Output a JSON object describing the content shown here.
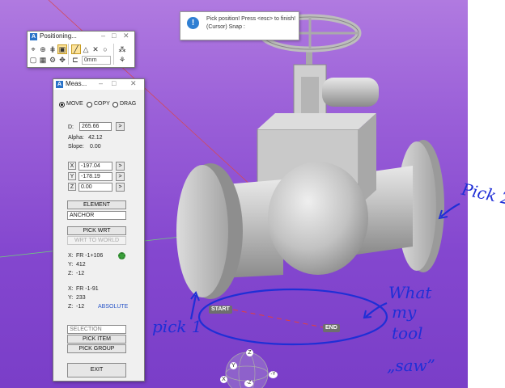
{
  "tooltip": {
    "line1": "Pick position! Press <esc> to finish!",
    "line2": "(Cursor) Snap :",
    "icon": "info-icon"
  },
  "positioning_window": {
    "title": "Positioning...",
    "snap_value": "0mm"
  },
  "measure_window": {
    "title": "Meas...",
    "modes": [
      "MOVE",
      "COPY",
      "DRAG"
    ],
    "selected_mode": "MOVE",
    "d_label": "D:",
    "d_value": "265.66",
    "alpha_label": "Alpha:",
    "alpha_value": "42.12",
    "slope_label": "Slope:",
    "slope_value": "0.00",
    "arrow_btn": ">",
    "x_label": "X",
    "x_value": "-197.04",
    "y_label": "Y",
    "y_value": "-178.19",
    "z_label": "Z",
    "z_value": "0.00",
    "element_btn": "ELEMENT",
    "anchor_value": "ANCHOR",
    "pick_wrt_btn": "PICK WRT",
    "wrt_to_world_btn": "WRT TO WORLD",
    "p1_x_label": "X:",
    "p1_x": "FR -1+106",
    "p1_y_label": "Y:",
    "p1_y": "412",
    "p1_z_label": "Z:",
    "p1_z": "-12",
    "p2_x_label": "X:",
    "p2_x": "FR -1-91",
    "p2_y_label": "Y:",
    "p2_y": "233",
    "p2_z_label": "Z:",
    "p2_z": "-12",
    "absolute_label": "ABSOLUTE",
    "selection_value": "SELECTION",
    "pick_item_btn": "PICK ITEM",
    "pick_group_btn": "PICK GROUP",
    "exit_btn": "EXIT"
  },
  "viewport": {
    "start_label": "START",
    "end_label": "END",
    "axis_labels": [
      "Z",
      "Y",
      "X",
      "-Y",
      "-Z"
    ]
  },
  "annotations": {
    "pick1": "pick 1",
    "pick2": "Pick 2",
    "what": "What",
    "my": "my",
    "tool": "tool",
    "saw": "„saw”"
  },
  "colors": {
    "viewport_top": "#b07ae0",
    "viewport_bottom": "#7a3ec8",
    "handwriting": "#1f2fd6",
    "info_icon": "#2f7fd3"
  }
}
